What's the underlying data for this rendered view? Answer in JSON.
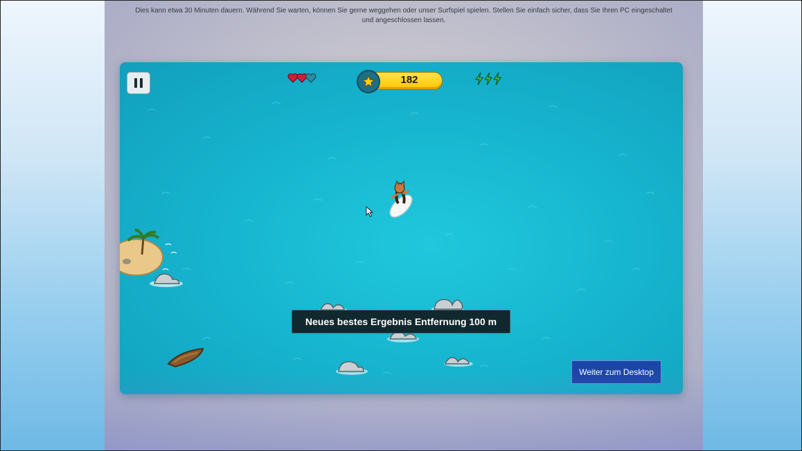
{
  "install_message": "Dies kann etwa 30 Minuten dauern. Während Sie warten, können Sie gerne weggehen oder unser Surfspiel spielen. Stellen Sie einfach sicher, dass Sie Ihren PC eingeschaltet und angeschlossen lassen.",
  "hud": {
    "pause_icon": "pause-icon",
    "lives": {
      "total": 3,
      "filled": 2,
      "icon": "heart-icon"
    },
    "score": "182",
    "score_icon": "star-icon",
    "boosts": {
      "total": 3,
      "icon": "lightning-bolt-icon"
    }
  },
  "toast": "Neues bestes Ergebnis Entfernung 100 m",
  "continue_button": "Weiter zum Desktop",
  "colors": {
    "water": "#17b6d0",
    "score_pill": "#ffc700",
    "heart": "#d81b36",
    "button": "#1c45a8",
    "bolt": "#37c24a"
  }
}
